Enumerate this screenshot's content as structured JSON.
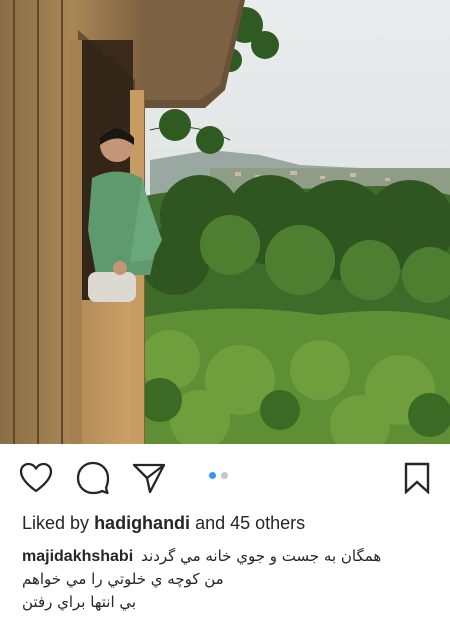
{
  "post": {
    "photo_alt": "",
    "carousel": {
      "count": 2,
      "active_index": 0
    },
    "icons": {
      "like": "heart-icon",
      "comment": "comment-icon",
      "share": "send-icon",
      "save": "bookmark-icon"
    },
    "likes": {
      "prefix": "Liked by",
      "user": "hadighandi",
      "suffix": "and 45 others"
    },
    "caption": {
      "author": "majidakhshabi",
      "lines": [
        "همگان به جست و جوي خانه مي گردند",
        "من كوچه ي خلوتي را مي خواهم",
        "بي انتها براي رفتن"
      ]
    },
    "colors": {
      "accent": "#3897f0",
      "text": "#262626",
      "inactive_dot": "#c7c7c7"
    }
  }
}
